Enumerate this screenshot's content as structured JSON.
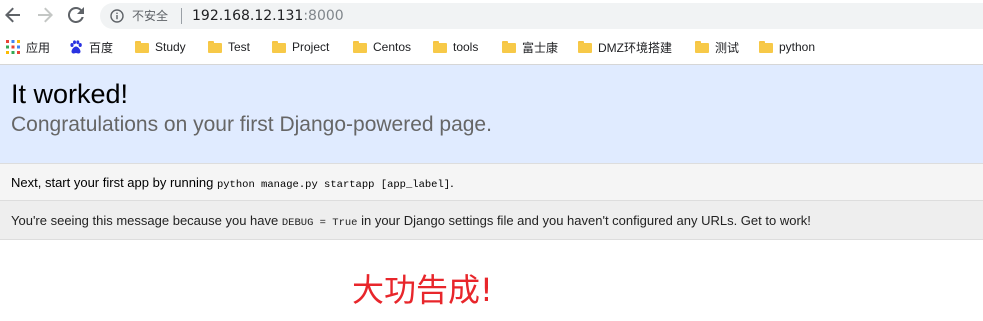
{
  "browser": {
    "security_label": "不安全",
    "url_host": "192.168.12.131",
    "url_port": ":8000"
  },
  "bookmarks": [
    {
      "label": "应用",
      "icon": "apps-grid-icon"
    },
    {
      "label": "百度",
      "icon": "baidu-paw-icon"
    },
    {
      "label": "Study",
      "icon": "folder-icon"
    },
    {
      "label": "Test",
      "icon": "folder-icon"
    },
    {
      "label": "Project",
      "icon": "folder-icon"
    },
    {
      "label": "Centos",
      "icon": "folder-icon"
    },
    {
      "label": "tools",
      "icon": "folder-icon"
    },
    {
      "label": "富士康",
      "icon": "folder-icon"
    },
    {
      "label": "DMZ环境搭建",
      "icon": "folder-icon"
    },
    {
      "label": "测试",
      "icon": "folder-icon"
    },
    {
      "label": "python",
      "icon": "folder-icon"
    }
  ],
  "page": {
    "title": "It worked!",
    "subtitle": "Congratulations on your first Django-powered page.",
    "instructions_prefix": "Next, start your first app by running ",
    "instructions_code": "python manage.py startapp [app_label]",
    "instructions_suffix": ".",
    "explanation_prefix": "You're seeing this message because you have ",
    "explanation_code": "DEBUG = True",
    "explanation_suffix": " in your Django settings file and you haven't configured any URLs. Get to work!"
  },
  "annotation": {
    "text": "大功告成!",
    "color": "#e8262b"
  },
  "colors": {
    "summary_bg": "#e0ebff",
    "folder": "#f7c948"
  }
}
